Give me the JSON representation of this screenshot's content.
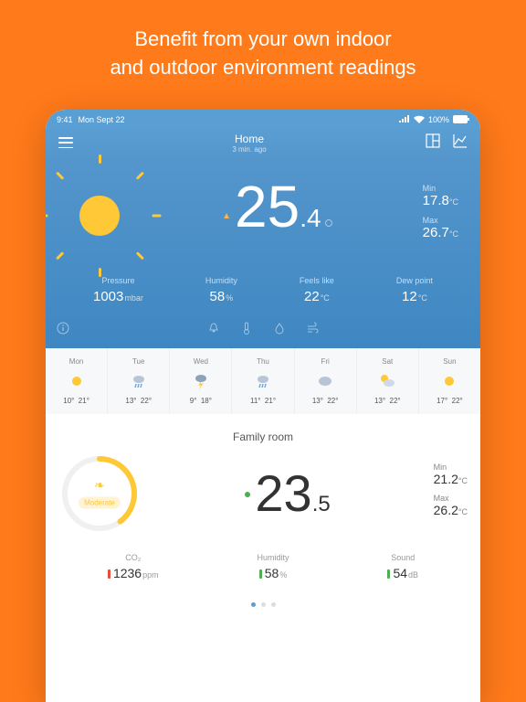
{
  "headline_l1": "Benefit from your own indoor",
  "headline_l2": "and outdoor environment readings",
  "status": {
    "time": "9:41",
    "date": "Mon Sept 22",
    "battery": "100%"
  },
  "header": {
    "location": "Home",
    "updated": "3 min. ago"
  },
  "outdoor": {
    "temp_int": "25",
    "temp_dec": ".4",
    "min_lbl": "Min",
    "min": "17.8",
    "min_unit": "°C",
    "max_lbl": "Max",
    "max": "26.7",
    "max_unit": "°C",
    "metrics": [
      {
        "lbl": "Pressure",
        "val": "1003",
        "unit": "mbar"
      },
      {
        "lbl": "Humidity",
        "val": "58",
        "unit": "%"
      },
      {
        "lbl": "Feels like",
        "val": "22",
        "unit": "°C"
      },
      {
        "lbl": "Dew point",
        "val": "12",
        "unit": "°C"
      }
    ]
  },
  "forecast": [
    {
      "d": "Mon",
      "lo": "10°",
      "hi": "21°",
      "icon": "sun"
    },
    {
      "d": "Tue",
      "lo": "13°",
      "hi": "22°",
      "icon": "rain"
    },
    {
      "d": "Wed",
      "lo": "9°",
      "hi": "18°",
      "icon": "storm"
    },
    {
      "d": "Thu",
      "lo": "11°",
      "hi": "21°",
      "icon": "rain"
    },
    {
      "d": "Fri",
      "lo": "13°",
      "hi": "22°",
      "icon": "cloud"
    },
    {
      "d": "Sat",
      "lo": "13°",
      "hi": "22°",
      "icon": "partly"
    },
    {
      "d": "Sun",
      "lo": "17°",
      "hi": "22°",
      "icon": "sun"
    }
  ],
  "indoor": {
    "title": "Family room",
    "gauge_label": "Moderate",
    "temp_int": "23",
    "temp_dec": ".5",
    "min_lbl": "Min",
    "min": "21.2",
    "min_unit": "°C",
    "max_lbl": "Max",
    "max": "26.2",
    "max_unit": "°C",
    "metrics": [
      {
        "lbl": "CO₂",
        "val": "1236",
        "unit": "ppm",
        "color": "red"
      },
      {
        "lbl": "Humidity",
        "val": "58",
        "unit": "%",
        "color": "green"
      },
      {
        "lbl": "Sound",
        "val": "54",
        "unit": "dB",
        "color": "green"
      }
    ]
  }
}
